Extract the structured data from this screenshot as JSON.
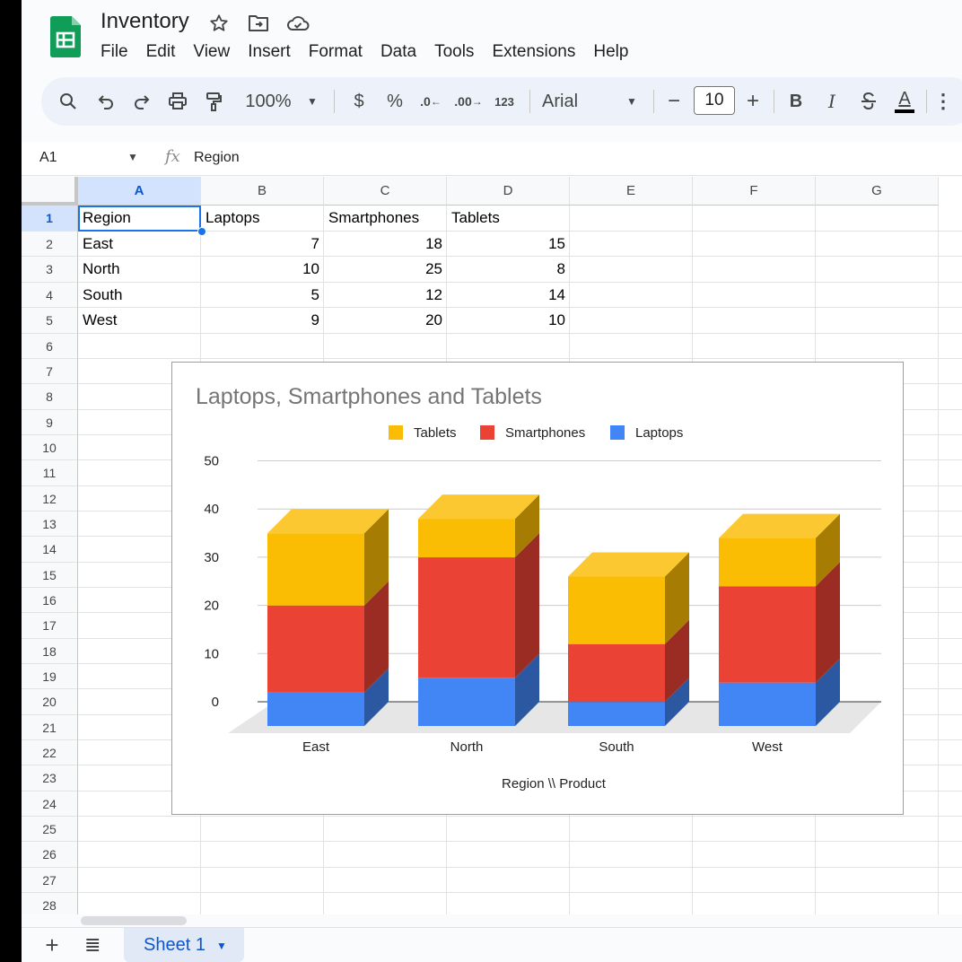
{
  "app": {
    "title": "Inventory",
    "icons": {
      "logo": "google-sheets-logo",
      "star": "star-icon",
      "move": "folder-move-icon",
      "cloud": "cloud-status-icon"
    }
  },
  "menu": [
    "File",
    "Edit",
    "View",
    "Insert",
    "Format",
    "Data",
    "Tools",
    "Extensions",
    "Help"
  ],
  "toolbar": {
    "zoom": "100%",
    "currency": "$",
    "percent": "%",
    "decrease_decimal": ".0",
    "increase_decimal": ".00",
    "more_formats": "123",
    "font": "Arial",
    "minus": "−",
    "font_size": "10",
    "plus": "+",
    "bold": "B",
    "italic": "I",
    "text_color": "A"
  },
  "formula_bar": {
    "cell_ref": "A1",
    "fx": "fx",
    "value": "Region"
  },
  "columns": [
    "A",
    "B",
    "C",
    "D",
    "E",
    "F",
    "G"
  ],
  "rows": [
    "1",
    "2",
    "3",
    "4",
    "5",
    "6",
    "7",
    "8",
    "9",
    "10",
    "11",
    "12",
    "13",
    "14",
    "15",
    "16",
    "17",
    "18",
    "19",
    "20",
    "21",
    "22",
    "23",
    "24",
    "25",
    "26",
    "27",
    "28"
  ],
  "cells": {
    "A1": "Region",
    "B1": "Laptops",
    "C1": "Smartphones",
    "D1": "Tablets",
    "A2": "East",
    "B2": "7",
    "C2": "18",
    "D2": "15",
    "A3": "North",
    "B3": "10",
    "C3": "25",
    "D3": "8",
    "A4": "South",
    "B4": "5",
    "C4": "12",
    "D4": "14",
    "A5": "West",
    "B5": "9",
    "C5": "20",
    "D5": "10"
  },
  "chart_data": {
    "type": "bar",
    "stacked": true,
    "three_d": true,
    "title": "Laptops, Smartphones and Tablets",
    "xlabel": "Region \\\\ Product",
    "ylabel": "",
    "categories": [
      "East",
      "North",
      "South",
      "West"
    ],
    "series": [
      {
        "name": "Laptops",
        "values": [
          7,
          10,
          5,
          9
        ],
        "color": "#4285f4"
      },
      {
        "name": "Smartphones",
        "values": [
          18,
          25,
          12,
          20
        ],
        "color": "#ea4335"
      },
      {
        "name": "Tablets",
        "values": [
          15,
          8,
          14,
          10
        ],
        "color": "#fbbc04"
      }
    ],
    "legend_order": [
      "Tablets",
      "Smartphones",
      "Laptops"
    ],
    "legend_position": "top",
    "yticks": [
      0,
      10,
      20,
      30,
      40,
      50
    ],
    "ylim": [
      0,
      50
    ],
    "grid": true
  },
  "sheets": {
    "active": "Sheet 1"
  }
}
